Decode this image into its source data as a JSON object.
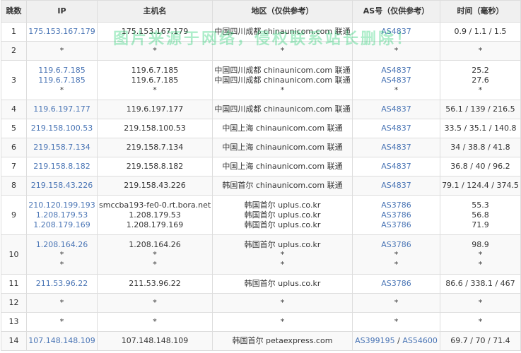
{
  "headers": {
    "hop": "跳数",
    "ip": "IP",
    "host": "主机名",
    "location": "地区（仅供参考）",
    "as": "AS号（仅供参考）",
    "time": "时间（毫秒）"
  },
  "watermark": "图片来源于网络，侵权联系站长删除！",
  "colors": {
    "link": "#4a75b5",
    "header_bg": "#f0f0f0",
    "border": "#dddddd",
    "watermark": "#00c85a"
  },
  "rows": [
    {
      "hop": "1",
      "ip": [
        "175.153.167.179"
      ],
      "host": [
        "175.153.167.179"
      ],
      "location": [
        "中国四川成都 chinaunicom.com 联通"
      ],
      "as": [
        [
          "AS4837"
        ]
      ],
      "time": [
        "0.9 / 1.1 / 1.5"
      ]
    },
    {
      "hop": "2",
      "ip": [
        "*"
      ],
      "host": [
        "*"
      ],
      "location": [
        "*"
      ],
      "as": [
        [
          "*"
        ]
      ],
      "time": [
        "*"
      ]
    },
    {
      "hop": "3",
      "ip": [
        "119.6.7.185",
        "119.6.7.185",
        "*"
      ],
      "host": [
        "119.6.7.185",
        "119.6.7.185",
        "*"
      ],
      "location": [
        "中国四川成都 chinaunicom.com 联通",
        "中国四川成都 chinaunicom.com 联通",
        "*"
      ],
      "as": [
        [
          "AS4837"
        ],
        [
          "AS4837"
        ],
        [
          "*"
        ]
      ],
      "time": [
        "25.2",
        "27.6",
        "*"
      ]
    },
    {
      "hop": "4",
      "ip": [
        "119.6.197.177"
      ],
      "host": [
        "119.6.197.177"
      ],
      "location": [
        "中国四川成都 chinaunicom.com 联通"
      ],
      "as": [
        [
          "AS4837"
        ]
      ],
      "time": [
        "56.1 / 139 / 216.5"
      ]
    },
    {
      "hop": "5",
      "ip": [
        "219.158.100.53"
      ],
      "host": [
        "219.158.100.53"
      ],
      "location": [
        "中国上海 chinaunicom.com 联通"
      ],
      "as": [
        [
          "AS4837"
        ]
      ],
      "time": [
        "33.5 / 35.1 / 140.8"
      ]
    },
    {
      "hop": "6",
      "ip": [
        "219.158.7.134"
      ],
      "host": [
        "219.158.7.134"
      ],
      "location": [
        "中国上海 chinaunicom.com 联通"
      ],
      "as": [
        [
          "AS4837"
        ]
      ],
      "time": [
        "34 / 38.8 / 41.8"
      ]
    },
    {
      "hop": "7",
      "ip": [
        "219.158.8.182"
      ],
      "host": [
        "219.158.8.182"
      ],
      "location": [
        "中国上海 chinaunicom.com 联通"
      ],
      "as": [
        [
          "AS4837"
        ]
      ],
      "time": [
        "36.8 / 40 / 96.2"
      ]
    },
    {
      "hop": "8",
      "ip": [
        "219.158.43.226"
      ],
      "host": [
        "219.158.43.226"
      ],
      "location": [
        "韩国首尔 chinaunicom.com 联通"
      ],
      "as": [
        [
          "AS4837"
        ]
      ],
      "time": [
        "79.1 / 124.4 / 374.5"
      ]
    },
    {
      "hop": "9",
      "ip": [
        "210.120.199.193",
        "1.208.179.53",
        "1.208.179.169"
      ],
      "host": [
        "smccba193-fe0-0.rt.bora.net",
        "1.208.179.53",
        "1.208.179.169"
      ],
      "location": [
        "韩国首尔 uplus.co.kr",
        "韩国首尔 uplus.co.kr",
        "韩国首尔 uplus.co.kr"
      ],
      "as": [
        [
          "AS3786"
        ],
        [
          "AS3786"
        ],
        [
          "AS3786"
        ]
      ],
      "time": [
        "55.3",
        "56.8",
        "71.9"
      ]
    },
    {
      "hop": "10",
      "ip": [
        "1.208.164.26",
        "*",
        "*"
      ],
      "host": [
        "1.208.164.26",
        "*",
        "*"
      ],
      "location": [
        "韩国首尔 uplus.co.kr",
        "*",
        "*"
      ],
      "as": [
        [
          "AS3786"
        ],
        [
          "*"
        ],
        [
          "*"
        ]
      ],
      "time": [
        "98.9",
        "*",
        "*"
      ]
    },
    {
      "hop": "11",
      "ip": [
        "211.53.96.22"
      ],
      "host": [
        "211.53.96.22"
      ],
      "location": [
        "韩国首尔 uplus.co.kr"
      ],
      "as": [
        [
          "AS3786"
        ]
      ],
      "time": [
        "86.6 / 338.1 / 467"
      ]
    },
    {
      "hop": "12",
      "ip": [
        "*"
      ],
      "host": [
        "*"
      ],
      "location": [
        "*"
      ],
      "as": [
        [
          "*"
        ]
      ],
      "time": [
        "*"
      ]
    },
    {
      "hop": "13",
      "ip": [
        "*"
      ],
      "host": [
        "*"
      ],
      "location": [
        "*"
      ],
      "as": [
        [
          "*"
        ]
      ],
      "time": [
        "*"
      ]
    },
    {
      "hop": "14",
      "ip": [
        "107.148.148.109"
      ],
      "host": [
        "107.148.148.109"
      ],
      "location": [
        "韩国首尔 petaexpress.com"
      ],
      "as": [
        [
          "AS399195",
          "AS54600"
        ]
      ],
      "time": [
        "69.7 / 70 / 71.4"
      ]
    }
  ]
}
